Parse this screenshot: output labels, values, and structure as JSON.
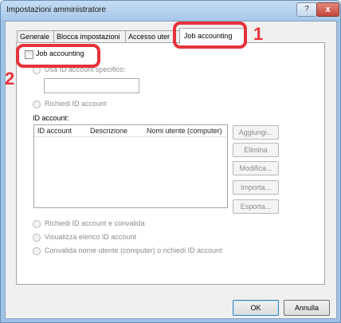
{
  "window": {
    "title": "Impostazioni amministratore",
    "help_glyph": "?",
    "close_glyph": "x"
  },
  "tabs": [
    {
      "label": "Generale"
    },
    {
      "label": "Blocca impostazioni"
    },
    {
      "label": "Accesso uter"
    },
    {
      "label": "Job accounting"
    }
  ],
  "panel": {
    "job_accounting_checkbox_label": "Job accounting",
    "radio_specific": "Usa ID account specifico:",
    "specific_input_value": "",
    "radio_request": "Richiedi ID account",
    "id_account_label": "ID account:",
    "columns": [
      "ID account",
      "Descrizione",
      "Nomi utente (computer)"
    ],
    "buttons": {
      "add": "Aggiungi...",
      "delete": "Elimina",
      "edit": "Modifica...",
      "import": "Importa...",
      "export": "Esporta..."
    },
    "radio_request_validate": "Richiedi ID account e convalida",
    "radio_show_list": "Visualizza elenco ID account",
    "radio_validate_name": "Convalida nome utente (computer) o richiedi ID account"
  },
  "footer": {
    "ok": "OK",
    "cancel": "Annulla"
  },
  "annotations": {
    "marker_1": "1",
    "marker_2": "2",
    "highlight_color": "#e6323b"
  }
}
